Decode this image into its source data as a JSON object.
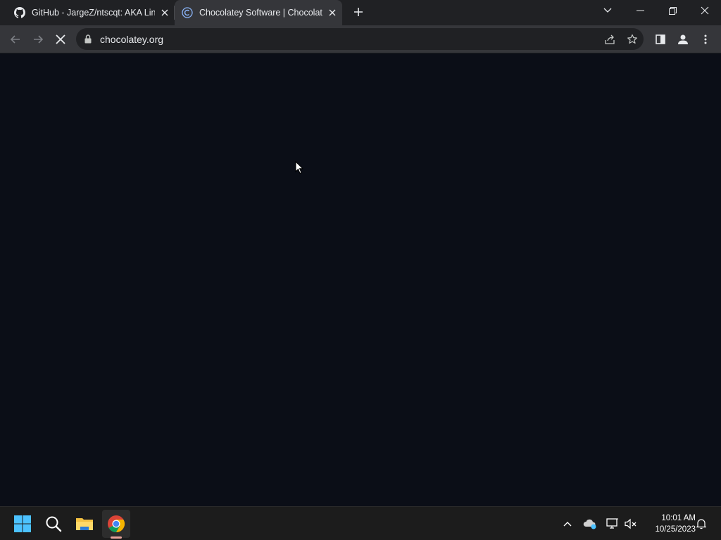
{
  "browser": {
    "tabs": [
      {
        "title": "GitHub - JargeZ/ntscqt: AKA Line",
        "icon": "github-icon",
        "active": false
      },
      {
        "title": "Chocolatey Software | Chocolatey",
        "icon": "chocolatey-icon",
        "active": true
      }
    ],
    "address_bar": {
      "url": "chocolatey.org"
    },
    "loading": true
  },
  "page": {
    "state": "blank-loading"
  },
  "taskbar": {
    "items": [
      "start-icon",
      "search-icon",
      "file-explorer-icon",
      "chrome-icon"
    ],
    "tray": [
      "chevron-up-icon",
      "onedrive-icon",
      "network-icon",
      "volume-muted-icon",
      "notification-icon"
    ],
    "clock": {
      "time": "10:01 AM",
      "date": "10/25/2023"
    }
  },
  "colors": {
    "tabstrip": "#202124",
    "toolbar": "#35363a",
    "page_bg": "#0b0e17",
    "taskbar": "#1c1c1c"
  }
}
